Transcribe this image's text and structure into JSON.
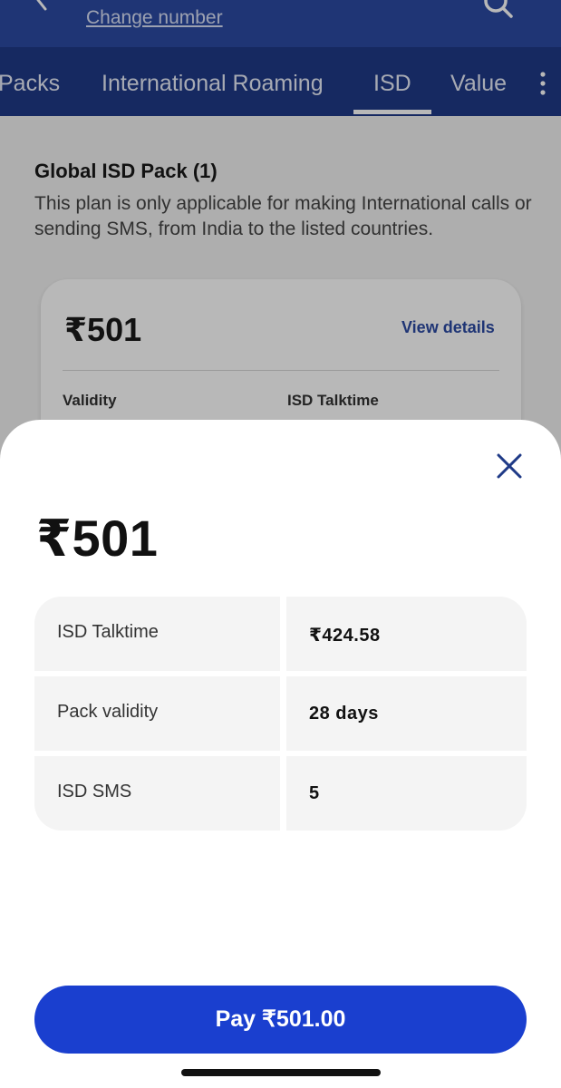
{
  "header": {
    "change_number": "Change number"
  },
  "tabs": {
    "items": [
      {
        "label": "Packs"
      },
      {
        "label": "International Roaming"
      },
      {
        "label": "ISD"
      },
      {
        "label": "Value"
      }
    ],
    "active": "ISD"
  },
  "section": {
    "title": "Global ISD Pack (1)",
    "description": "This plan is only applicable for making International calls or sending SMS, from India to the listed countries."
  },
  "plan_card": {
    "price": "₹501",
    "view_details": "View details",
    "validity_label": "Validity",
    "talktime_label": "ISD Talktime"
  },
  "sheet": {
    "price": "₹501",
    "rows": [
      {
        "label": "ISD Talktime",
        "value": "₹424.58"
      },
      {
        "label": "Pack validity",
        "value": "28 days"
      },
      {
        "label": "ISD SMS",
        "value": "5"
      }
    ],
    "pay_label": "Pay ₹501.00"
  },
  "colors": {
    "header": "#2c4aa3",
    "tabs": "#1f3a87",
    "accent": "#1a3fcf",
    "link": "#2c4aa3"
  },
  "icons": {
    "back": "chevron-left-icon",
    "search": "search-icon",
    "more": "more-vertical-icon",
    "close": "close-icon"
  }
}
